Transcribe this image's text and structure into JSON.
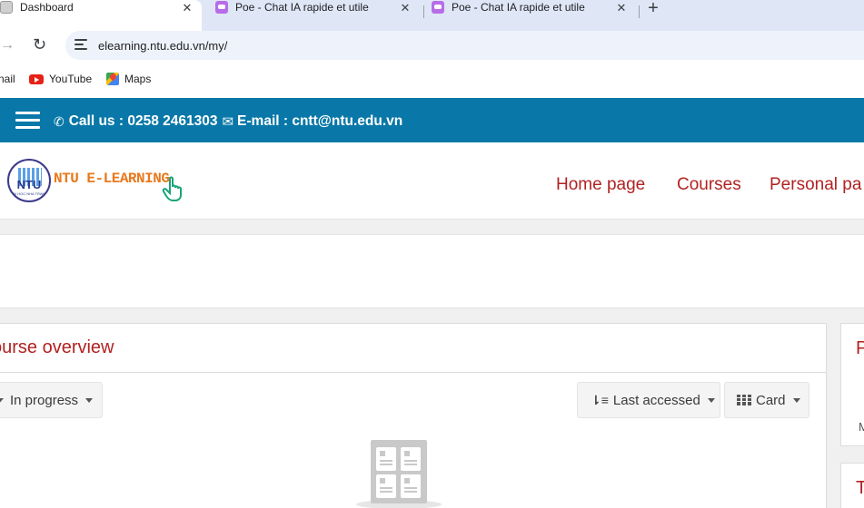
{
  "browser": {
    "tabs": [
      {
        "title": "Dashboard",
        "close": "✕"
      },
      {
        "title": "Poe - Chat IA rapide et utile",
        "close": "✕"
      },
      {
        "title": "Poe - Chat IA rapide et utile",
        "close": "✕"
      }
    ],
    "new_tab": "+",
    "back_icon": "→",
    "reload_icon": "↻",
    "url": "elearning.ntu.edu.vn/my/",
    "bookmarks": [
      {
        "label": "nail",
        "icon": "gmail-icon"
      },
      {
        "label": "YouTube",
        "icon": "youtube-icon"
      },
      {
        "label": "Maps",
        "icon": "maps-icon"
      }
    ]
  },
  "topbar": {
    "phone_icon": "✆",
    "phone_text": "Call us : 0258 2461303",
    "email_icon": "✉",
    "email_text": "E-mail : cntt@ntu.edu.vn",
    "background": "#0978a8"
  },
  "header": {
    "logo_badge_text": "NTU",
    "logo_badge_sub": "ĐẠI HỌC NHA TRANG",
    "logo_text": "NTU E-LEARNING",
    "nav": [
      "Home page",
      "Courses",
      "Personal pa"
    ],
    "nav_color": "#b22222"
  },
  "course_overview": {
    "title": "ourse overview",
    "filter_label": "In progress",
    "sort_icon": "⇂≡",
    "sort_label": "Last accessed",
    "view_label": "Card"
  },
  "side_blocks": [
    {
      "heading": "P",
      "text": "M"
    },
    {
      "heading": "T"
    }
  ]
}
